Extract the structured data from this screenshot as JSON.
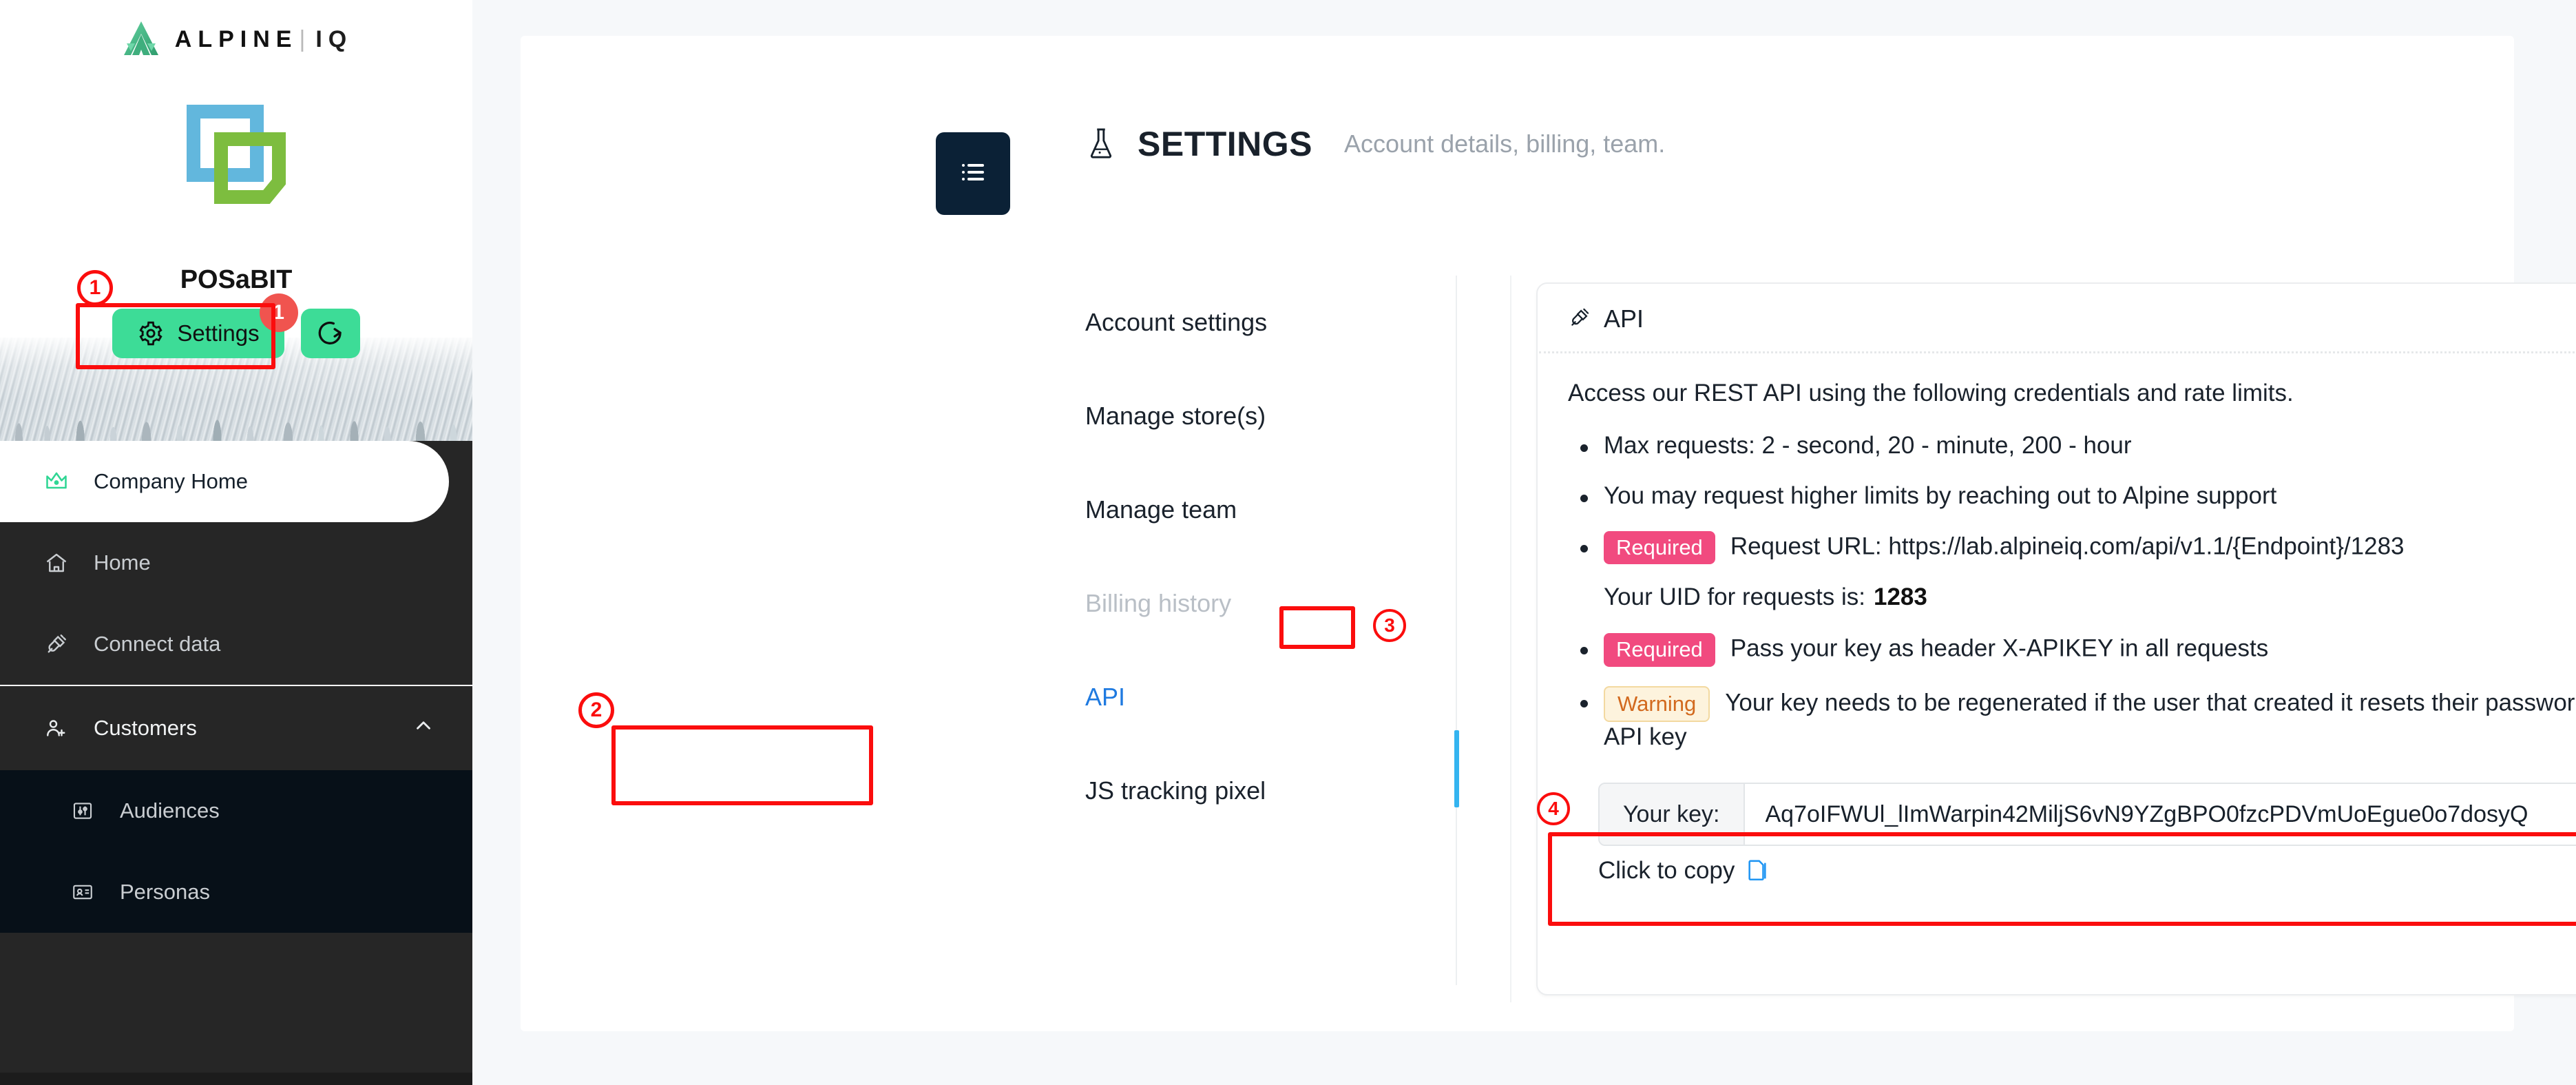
{
  "brand": {
    "name_main": "ALPINE",
    "name_sub": "IQ",
    "divider": "|",
    "logo_icon": "alpine-triangle-logo"
  },
  "sidebar": {
    "company_name": "POSaBIT",
    "company_logo_icon": "posabit-squares-logo",
    "settings_button": {
      "label": "Settings",
      "icon": "gear-icon",
      "badge_count": "1",
      "accent": "#3ddc97",
      "badge_color": "#f0544f"
    },
    "logout_button": {
      "icon": "logout-icon",
      "accent": "#3ddc97"
    },
    "nav": [
      {
        "label": "Company Home",
        "icon": "crown-icon",
        "active": true
      },
      {
        "label": "Home",
        "icon": "house-icon",
        "active": false
      },
      {
        "label": "Connect data",
        "icon": "plug-icon",
        "active": false
      }
    ],
    "group": {
      "label": "Customers",
      "icon": "users-add-icon",
      "chevron": "chevron-up-icon",
      "children": [
        {
          "label": "Audiences",
          "icon": "sliders-icon"
        },
        {
          "label": "Personas",
          "icon": "id-card-icon"
        }
      ]
    }
  },
  "header": {
    "menu_icon": "hamburger-list-icon",
    "flask_icon": "flask-icon",
    "title": "SETTINGS",
    "subtitle": "Account details, billing, team."
  },
  "settings_nav": [
    {
      "label": "Account settings",
      "state": "normal"
    },
    {
      "label": "Manage store(s)",
      "state": "normal"
    },
    {
      "label": "Manage team",
      "state": "normal"
    },
    {
      "label": "Billing history",
      "state": "muted"
    },
    {
      "label": "API",
      "state": "selected"
    },
    {
      "label": "JS tracking pixel",
      "state": "normal"
    }
  ],
  "api_card": {
    "icon": "plug-icon",
    "title": "API",
    "intro": "Access our REST API using the following credentials and rate limits.",
    "bullets": [
      {
        "tag": null,
        "text": "Max requests: 2 - second, 20 - minute, 200 - hour"
      },
      {
        "tag": null,
        "text": "You may request higher limits by reaching out to Alpine support"
      },
      {
        "tag": "Required",
        "tag_type": "required",
        "text": "Request URL: https://lab.alpineiq.com/api/v1.1/{Endpoint}/1283"
      },
      {
        "tag": "Required",
        "tag_type": "required",
        "text": "Pass your key as header X-APIKEY in all requests"
      },
      {
        "tag": "Warning",
        "tag_type": "warning",
        "text": "Your key needs to be regenerated if the user that created it resets their password, as it will also invalidate the API key"
      }
    ],
    "uid_line": {
      "prefix": "Your UID for requests is:",
      "value": "1283"
    },
    "key_field": {
      "label": "Your key:",
      "value": "Aq7oIFWUl_lImWarpin42MiljS6vN9YZgBPO0fzcPDVmUoEgue0o7dosyQ",
      "regenerate_icon": "regenerate-key-icon",
      "reveal_icon": "eye-icon"
    },
    "copy": {
      "label": "Click to copy",
      "icon": "copy-icon"
    }
  },
  "annotations": [
    {
      "id": "1",
      "target": "settings-button"
    },
    {
      "id": "2",
      "target": "settings-nav-api"
    },
    {
      "id": "3",
      "target": "uid-value"
    },
    {
      "id": "4",
      "target": "api-key-field"
    }
  ],
  "colors": {
    "accent_green": "#3ddc97",
    "annotation_red": "#fb0d0d",
    "link_blue": "#1f7ae0",
    "tag_required": "#f14a7f",
    "tag_warning_text": "#d2691e",
    "sidebar_bg": "#262626"
  }
}
